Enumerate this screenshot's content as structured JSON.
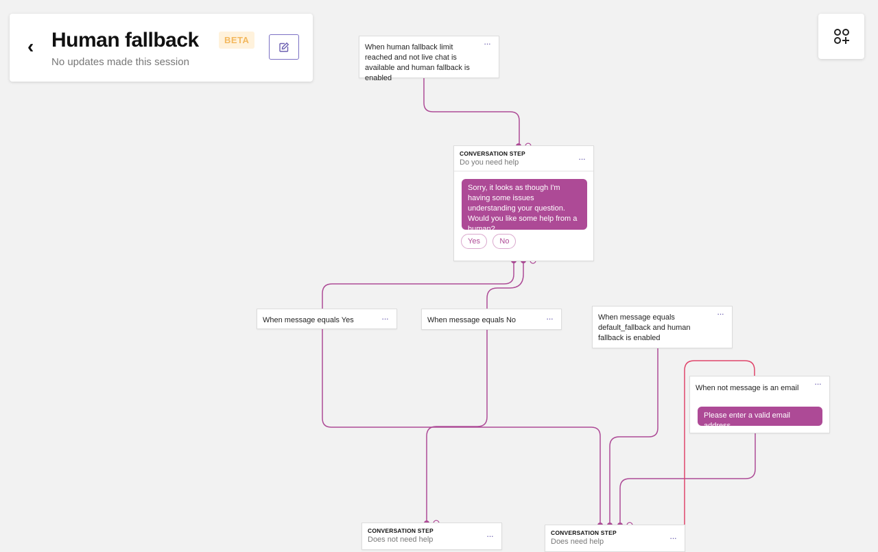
{
  "header": {
    "title": "Human fallback",
    "badge": "BETA",
    "subtitle": "No updates made this session"
  },
  "toolbar": {
    "add_icon": "add-node-icon",
    "edit_icon": "edit-icon"
  },
  "conditions": {
    "limit_reached": "When human fallback limit reached and not live chat is available and human fallback is enabled",
    "equals_yes": "When message equals Yes",
    "equals_no": "When message equals No",
    "default_fallback": "When message equals default_fallback and human fallback is enabled",
    "not_email": "When not message is an email",
    "not_email_reply": "Please enter a valid email address"
  },
  "steps": {
    "kicker": "CONVERSATION STEP",
    "do_you_need_help": {
      "name": "Do you need help",
      "message": "Sorry, it looks as though I'm having some issues understanding your question. Would you like some help from a human?",
      "quick_replies": [
        "Yes",
        "No"
      ]
    },
    "does_not_need_help": {
      "name": "Does not need help"
    },
    "does_need_help": {
      "name": "Does need help"
    }
  },
  "menu_glyph": "···",
  "colors": {
    "accent": "#ad4a96",
    "error_wire": "#e0446a",
    "icon": "#6b5fb0",
    "beta_text": "#f3b85e",
    "beta_bg": "#fff2dc"
  }
}
